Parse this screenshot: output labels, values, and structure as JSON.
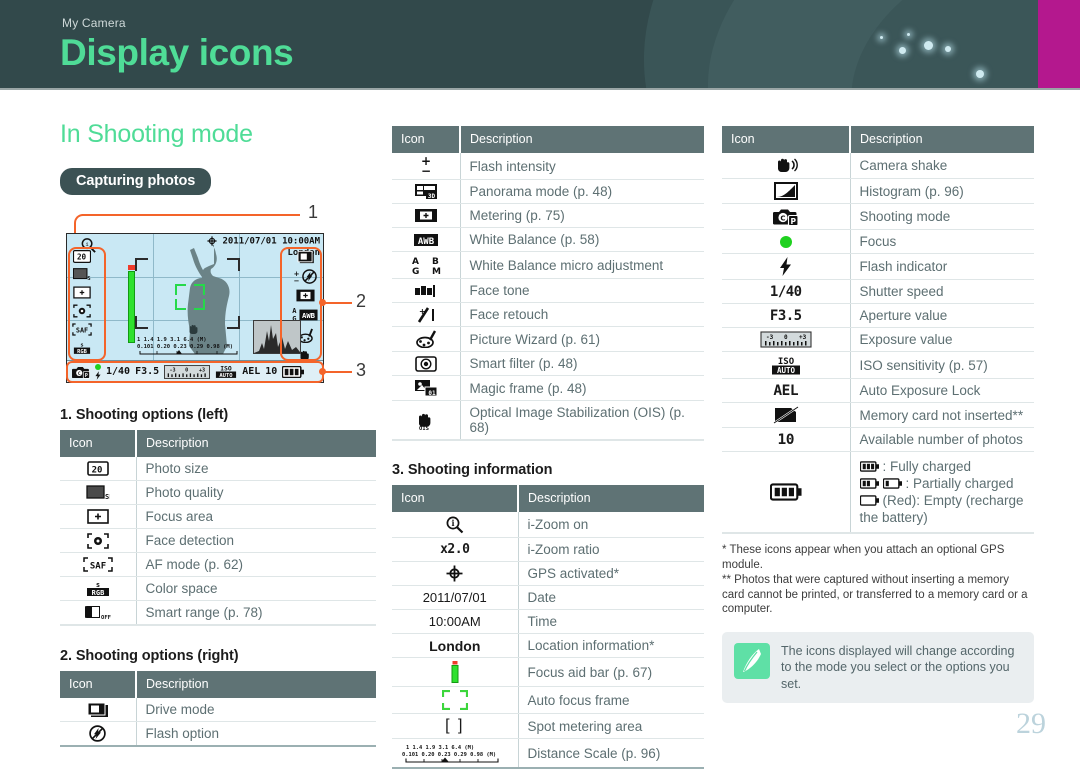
{
  "header": {
    "kicker": "My Camera",
    "title": "Display icons",
    "accent_green": "#4fdc97",
    "banner_color": "#32494b",
    "magenta_block": "#b4188e"
  },
  "section": {
    "heading": "In Shooting mode",
    "pill": "Capturing photos"
  },
  "lcd": {
    "gps_date": "2011/07/01",
    "time": "10:00AM",
    "location": "London",
    "shutter_speed": "1/40",
    "aperture": "F3.5",
    "ev_scale": "-3  0  +3",
    "iso": "ISO AUTO",
    "ael": "AEL",
    "shots": "10",
    "zoom_ratio": "x2.0",
    "distance_scale_top": "1   1.4   1.9   3.1   6.4   (M)",
    "distance_scale_bottom": "0.101  0.20  0.23  0.29  0.98  (M)",
    "callouts": [
      "1",
      "2",
      "3"
    ]
  },
  "tables": {
    "left": {
      "title": "1. Shooting options (left)",
      "headers": [
        "Icon",
        "Description"
      ],
      "rows": [
        {
          "icon": "photo-size-20m-icon",
          "desc": "Photo size"
        },
        {
          "icon": "photo-quality-sf-icon",
          "desc": "Photo quality"
        },
        {
          "icon": "focus-area-icon",
          "desc": "Focus area"
        },
        {
          "icon": "face-detection-icon",
          "desc": "Face detection"
        },
        {
          "icon": "af-mode-saf-icon",
          "desc": "AF mode (p. 62)"
        },
        {
          "icon": "color-space-srgb-icon",
          "desc": "Color space"
        },
        {
          "icon": "smart-range-off-icon",
          "desc": "Smart range (p. 78)"
        }
      ]
    },
    "left2": {
      "title": "2. Shooting options (right)",
      "headers": [
        "Icon",
        "Description"
      ],
      "rows": [
        {
          "icon": "drive-mode-icon",
          "desc": "Drive mode"
        },
        {
          "icon": "flash-off-icon",
          "desc": "Flash option"
        }
      ]
    },
    "mid": {
      "headers": [
        "Icon",
        "Description"
      ],
      "rows": [
        {
          "icon": "flash-intensity-plus-minus-icon",
          "desc": "Flash intensity"
        },
        {
          "icon": "panorama-3d-icon",
          "desc": "Panorama mode (p. 48)"
        },
        {
          "icon": "metering-icon",
          "desc": "Metering (p. 75)"
        },
        {
          "icon": "white-balance-awb-icon",
          "desc": "White Balance (p. 58)"
        },
        {
          "icon": "wb-micro-adjust-abgm-icon",
          "desc": "White Balance micro adjustment"
        },
        {
          "icon": "face-tone-icon",
          "desc": "Face tone"
        },
        {
          "icon": "face-retouch-icon",
          "desc": "Face retouch"
        },
        {
          "icon": "picture-wizard-icon",
          "desc": "Picture Wizard (p. 61)"
        },
        {
          "icon": "smart-filter-icon",
          "desc": "Smart filter (p. 48)"
        },
        {
          "icon": "magic-frame-icon",
          "desc": "Magic frame (p. 48)"
        },
        {
          "icon": "ois-icon",
          "desc": "Optical Image Stabilization (OIS) (p. 68)"
        }
      ]
    },
    "info": {
      "title": "3. Shooting information",
      "headers": [
        "Icon",
        "Description"
      ],
      "rows": [
        {
          "icon": "izoom-on-icon",
          "label": "",
          "desc": "i-Zoom on"
        },
        {
          "icon": "izoom-ratio-text",
          "label": "x2.0",
          "desc": "i-Zoom ratio"
        },
        {
          "icon": "gps-activated-icon",
          "label": "",
          "desc": "GPS activated*"
        },
        {
          "icon": "date-text",
          "label": "2011/07/01",
          "desc": "Date"
        },
        {
          "icon": "time-text",
          "label": "10:00AM",
          "desc": "Time"
        },
        {
          "icon": "location-text",
          "label": "London",
          "desc": "Location information*"
        },
        {
          "icon": "focus-aid-bar-icon",
          "label": "",
          "desc": "Focus aid bar (p. 67)"
        },
        {
          "icon": "auto-focus-frame-icon",
          "label": "",
          "desc": "Auto focus frame"
        },
        {
          "icon": "spot-metering-area-icon",
          "label": "[   ]",
          "desc": "Spot metering area"
        },
        {
          "icon": "distance-scale-icon",
          "label": "",
          "desc": "Distance Scale (p. 96)"
        }
      ]
    },
    "right": {
      "headers": [
        "Icon",
        "Description"
      ],
      "rows": [
        {
          "icon": "camera-shake-icon",
          "label": "",
          "desc": "Camera shake"
        },
        {
          "icon": "histogram-icon",
          "label": "",
          "desc": "Histogram (p. 96)"
        },
        {
          "icon": "shooting-mode-icon",
          "label": "",
          "desc": "Shooting mode"
        },
        {
          "icon": "focus-dot-icon",
          "label": "",
          "desc": "Focus"
        },
        {
          "icon": "flash-indicator-icon",
          "label": "",
          "desc": "Flash indicator"
        },
        {
          "icon": "shutter-speed-text",
          "label": "1/40",
          "desc": "Shutter speed"
        },
        {
          "icon": "aperture-value-text",
          "label": "F3.5",
          "desc": "Aperture value"
        },
        {
          "icon": "exposure-value-icon",
          "label": "",
          "desc": "Exposure value"
        },
        {
          "icon": "iso-sensitivity-icon",
          "label": "",
          "desc": "ISO sensitivity (p. 57)"
        },
        {
          "icon": "ael-text",
          "label": "AEL",
          "desc": "Auto Exposure Lock"
        },
        {
          "icon": "memory-card-not-inserted-icon",
          "label": "",
          "desc": "Memory card not inserted**"
        },
        {
          "icon": "available-photos-text",
          "label": "10",
          "desc": "Available number of photos"
        }
      ],
      "battery_row": {
        "icon": "battery-icon",
        "lines": [
          ": Fully charged",
          ": Partially charged",
          "(Red): Empty (recharge",
          "the battery)"
        ]
      }
    }
  },
  "footnotes": [
    "* These icons appear when you attach an optional GPS module.",
    "** Photos that were captured without inserting a memory card cannot be printed, or transferred to a memory card or a computer."
  ],
  "tip": {
    "icon": "pen-tip-icon",
    "text": "The icons displayed will change according to the mode you select or the options you set."
  },
  "page_number": "29"
}
